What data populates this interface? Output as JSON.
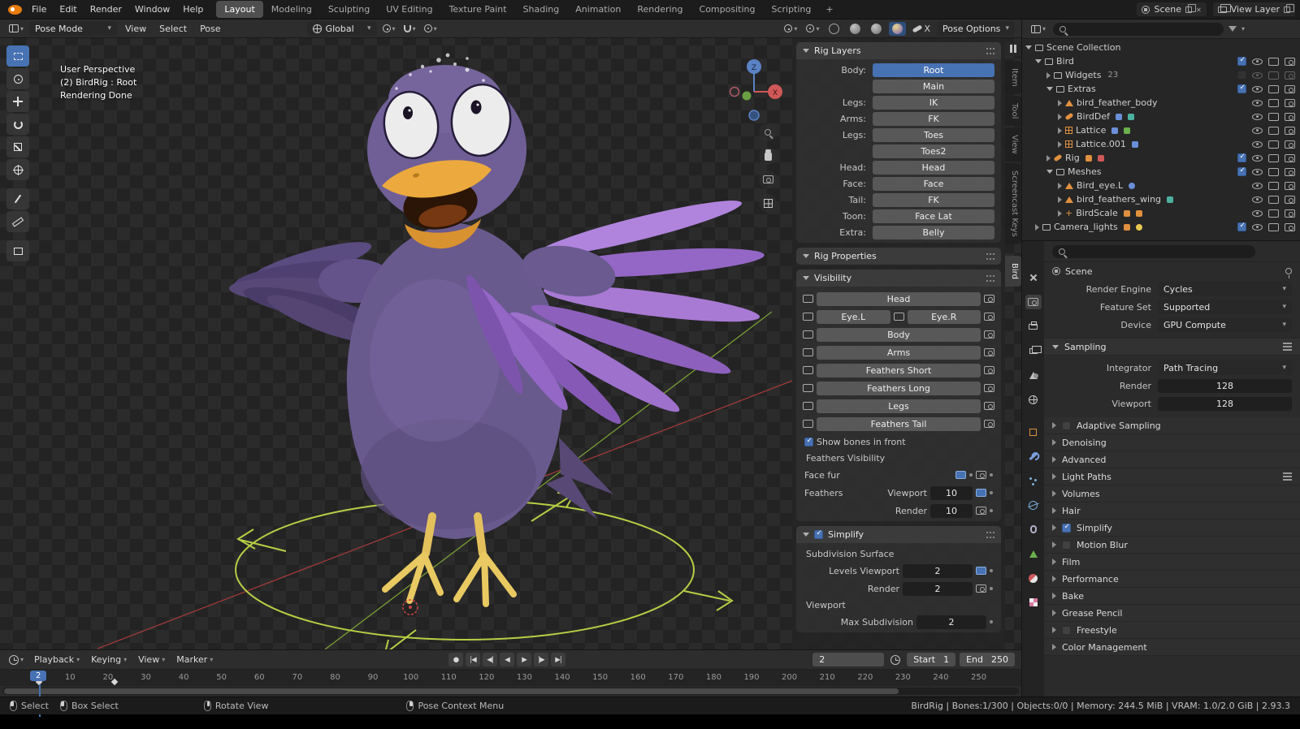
{
  "topbar": {
    "menus": [
      "File",
      "Edit",
      "Render",
      "Window",
      "Help"
    ],
    "workspaces": [
      "Layout",
      "Modeling",
      "Sculpting",
      "UV Editing",
      "Texture Paint",
      "Shading",
      "Animation",
      "Rendering",
      "Compositing",
      "Scripting"
    ],
    "add_workspace": "+",
    "scene_name": "Scene",
    "view_layer_name": "View Layer"
  },
  "viewport": {
    "header": {
      "mode": "Pose Mode",
      "menus": [
        "View",
        "Select",
        "Pose"
      ],
      "orientation": "Global",
      "mirror_x": "X",
      "pose_options": "Pose Options"
    },
    "overlay": [
      "User Perspective",
      "(2) BirdRig : Root",
      "Rendering Done"
    ],
    "gizmo": {
      "z_label": "Z",
      "x_label": "X"
    }
  },
  "sidebar": {
    "tabs": [
      "Item",
      "Tool",
      "View",
      "Screencast Keys",
      "Bird"
    ],
    "active_tab": "Bird",
    "rig_layers": {
      "title": "Rig Layers",
      "rows": [
        {
          "label": "Body:",
          "button": "Root"
        },
        {
          "label": "",
          "button": "Main"
        },
        {
          "label": "Legs:",
          "button": "IK"
        },
        {
          "label": "Arms:",
          "button": "FK"
        },
        {
          "label": "Legs:",
          "button": "Toes"
        },
        {
          "label": "",
          "button": "Toes2"
        },
        {
          "label": "Head:",
          "button": "Head"
        },
        {
          "label": "Face:",
          "button": "Face"
        },
        {
          "label": "Tail:",
          "button": "FK"
        },
        {
          "label": "Toon:",
          "button": "Face Lat"
        },
        {
          "label": "Extra:",
          "button": "Belly"
        }
      ]
    },
    "rig_properties_title": "Rig Properties",
    "visibility": {
      "title": "Visibility",
      "buttons": [
        "Head",
        "Eye.L",
        "Eye.R",
        "Body",
        "Arms",
        "Feathers Short",
        "Feathers Long",
        "Legs",
        "Feathers Tail"
      ],
      "show_bones": "Show bones in front",
      "feathers_visibility": "Feathers Visibility",
      "face_fur": "Face fur",
      "feathers": "Feathers",
      "viewport_label": "Viewport",
      "viewport_value": "10",
      "render_label": "Render",
      "render_value": "10"
    },
    "simplify": {
      "title": "Simplify",
      "subdivision_surface": "Subdivision Surface",
      "levels_viewport_label": "Levels Viewport",
      "levels_viewport_value": "2",
      "render_label": "Render",
      "render_value": "2",
      "viewport_label": "Viewport",
      "max_subdivision_label": "Max Subdivision",
      "max_subdivision_value": "2"
    }
  },
  "outliner": {
    "rows": [
      {
        "name": "Scene Collection"
      },
      {
        "name": "Bird"
      },
      {
        "name": "Widgets",
        "badge": "23"
      },
      {
        "name": "Extras"
      },
      {
        "name": "bird_feather_body"
      },
      {
        "name": "BirdDef"
      },
      {
        "name": "Lattice"
      },
      {
        "name": "Lattice.001"
      },
      {
        "name": "Rig"
      },
      {
        "name": "Meshes"
      },
      {
        "name": "Bird_eye.L"
      },
      {
        "name": "bird_feathers_wing"
      },
      {
        "name": "BirdScale"
      },
      {
        "name": "Camera_lights"
      }
    ]
  },
  "properties": {
    "breadcrumb": "Scene",
    "render_engine_label": "Render Engine",
    "render_engine_value": "Cycles",
    "feature_set_label": "Feature Set",
    "feature_set_value": "Supported",
    "device_label": "Device",
    "device_value": "GPU Compute",
    "sampling": {
      "title": "Sampling",
      "integrator_label": "Integrator",
      "integrator_value": "Path Tracing",
      "render_label": "Render",
      "render_value": "128",
      "viewport_label": "Viewport",
      "viewport_value": "128"
    },
    "panels": [
      {
        "label": "Adaptive Sampling"
      },
      {
        "label": "Denoising"
      },
      {
        "label": "Advanced"
      },
      {
        "label": "Light Paths"
      },
      {
        "label": "Volumes"
      },
      {
        "label": "Hair"
      },
      {
        "label": "Simplify"
      },
      {
        "label": "Motion Blur"
      },
      {
        "label": "Film"
      },
      {
        "label": "Performance"
      },
      {
        "label": "Bake"
      },
      {
        "label": "Grease Pencil"
      },
      {
        "label": "Freestyle"
      },
      {
        "label": "Color Management"
      }
    ]
  },
  "timeline": {
    "menus": [
      "Playback",
      "Keying",
      "View",
      "Marker"
    ],
    "transport": [
      "●",
      "|◀",
      "◀|",
      "◀",
      "▶",
      "|▶",
      "▶|"
    ],
    "current_frame": "2",
    "start_label": "Start",
    "start_value": "1",
    "end_label": "End",
    "end_value": "250",
    "ruler": [
      "10",
      "20",
      "30",
      "40",
      "50",
      "60",
      "70",
      "80",
      "90",
      "100",
      "110",
      "120",
      "130",
      "140",
      "150",
      "160",
      "170",
      "180",
      "190",
      "200",
      "210",
      "220",
      "230",
      "240",
      "250"
    ],
    "playhead": "2"
  },
  "statusbar": {
    "items": [
      "Select",
      "Box Select",
      "Rotate View",
      "Pose Context Menu"
    ],
    "right": "BirdRig | Bones:1/300 | Objects:0/0 | Memory: 244.5 MiB | VRAM: 1.0/2.0 GiB | 2.93.3"
  }
}
